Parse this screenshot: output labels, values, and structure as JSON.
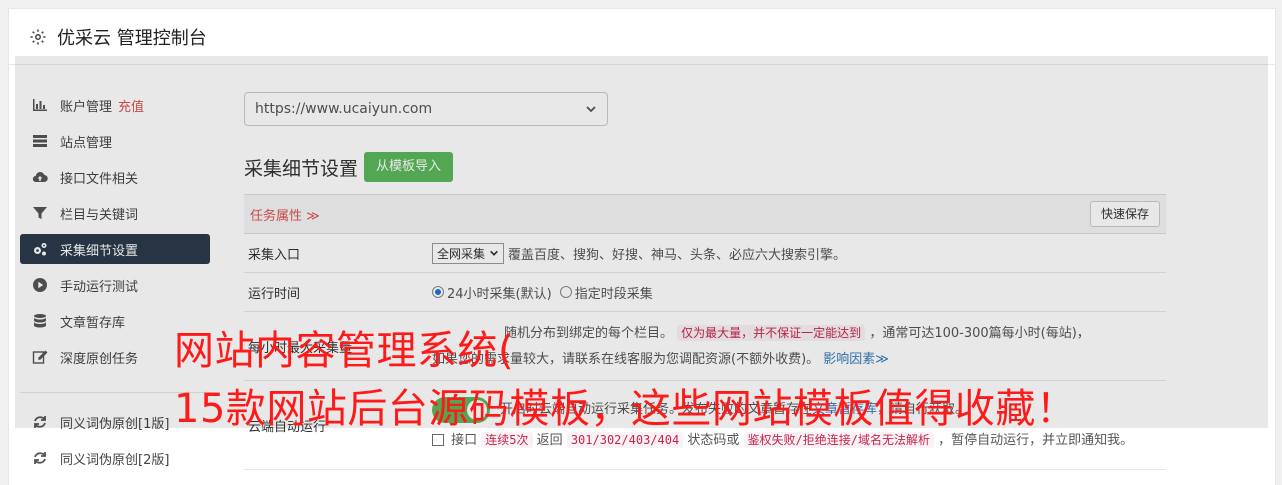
{
  "header": {
    "title": "优采云 管理控制台",
    "icon": "gear-icon"
  },
  "sidebar": {
    "items": [
      {
        "label": "账户管理",
        "extra": "充值",
        "icon": "bar-chart-icon"
      },
      {
        "label": "站点管理",
        "icon": "server-icon"
      },
      {
        "label": "接口文件相关",
        "icon": "cloud-upload-icon"
      },
      {
        "label": "栏目与关键词",
        "icon": "filter-icon"
      },
      {
        "label": "采集细节设置",
        "icon": "gears-icon",
        "active": true
      },
      {
        "label": "手动运行测试",
        "icon": "play-circle-icon"
      },
      {
        "label": "文章暂存库",
        "icon": "database-icon"
      },
      {
        "label": "深度原创任务",
        "icon": "edit-icon"
      },
      {
        "label": "同义词伪原创[1版]",
        "icon": "refresh-icon"
      },
      {
        "label": "同义词伪原创[2版]",
        "icon": "refresh-icon"
      }
    ]
  },
  "main": {
    "url_select": "https://www.ucaiyun.com",
    "section_title": "采集细节设置",
    "import_button": "从模板导入",
    "task_attr_label": "任务属性 ≫",
    "save_button": "快速保存",
    "rows": {
      "entry": {
        "label": "采集入口",
        "select": "全网采集",
        "desc": "覆盖百度、搜狗、好搜、神马、头条、必应六大搜索引擎。"
      },
      "runtime": {
        "label": "运行时间",
        "opt1": "24小时采集(默认)",
        "opt2": "指定时段采集"
      },
      "max": {
        "label": "每小时最大采集量",
        "line1_pre": "随机分布到绑定的每个栏目。",
        "line1_tag": "仅为最大量，并不保证一定能达到",
        "line1_post": "，通常可达100-300篇每小时(每站)，",
        "line2": "如果您的需求量较大，请联系在线客服为您调配资源(不额外收费)。",
        "line2_link": "影响因素≫"
      },
      "cloud": {
        "label": "云端自动运行",
        "line1_pre": "开启时云端自动运行采集任务。发布失败的文章暂存在",
        "line1_link": "文章暂存库",
        "line1_post": "，请自行获取。",
        "line2_a": "接口",
        "line2_tag1": "连续5次",
        "line2_b": "返回",
        "line2_tag2": "301/302/403/404",
        "line2_c": "状态码或",
        "line2_tag3": "鉴权失败/拒绝连接/域名无法解析",
        "line2_d": "，暂停自动运行，并立即通知我。"
      }
    }
  },
  "watermark": {
    "line1": "网站内容管理系统(",
    "line2": "15款网站后台源码模板，这些网站模板值得收藏！"
  }
}
